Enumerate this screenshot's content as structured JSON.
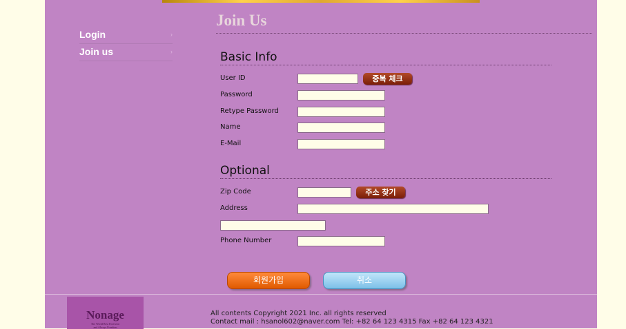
{
  "sidebar": {
    "items": [
      {
        "label": "Login"
      },
      {
        "label": "Join us"
      }
    ],
    "chevron": "›"
  },
  "page_title": "Join Us",
  "basic_info": {
    "title": "Basic Info",
    "user_id_label": "User ID",
    "check_button": "중복 체크",
    "password_label": "Password",
    "retype_label": "Retype Password",
    "name_label": "Name",
    "email_label": "E-Mail"
  },
  "optional": {
    "title": "Optional",
    "zip_label": "Zip Code",
    "find_address_button": "주소 찾기",
    "address_label": "Address",
    "phone_label": "Phone Number"
  },
  "buttons": {
    "signup": "회원가입",
    "cancel": "취소"
  },
  "footer": {
    "logo_name": "Nonage",
    "logo_tagline_1": "The World Best Footwear",
    "logo_tagline_2": "and Always Freedom",
    "copyright": "All contents Copyright 2021 Inc. all rights reserved",
    "contact": "Contact mail : hsanol602@naver.com Tel: +82 64 123 4315 Fax +82 64 123 4321"
  },
  "colors": {
    "page_bg": "#fffde8",
    "content_bg": "#c084c4",
    "accent_brown": "#7a1e08",
    "signup_orange": "#e05a00",
    "cancel_blue": "#7cc0e8"
  }
}
